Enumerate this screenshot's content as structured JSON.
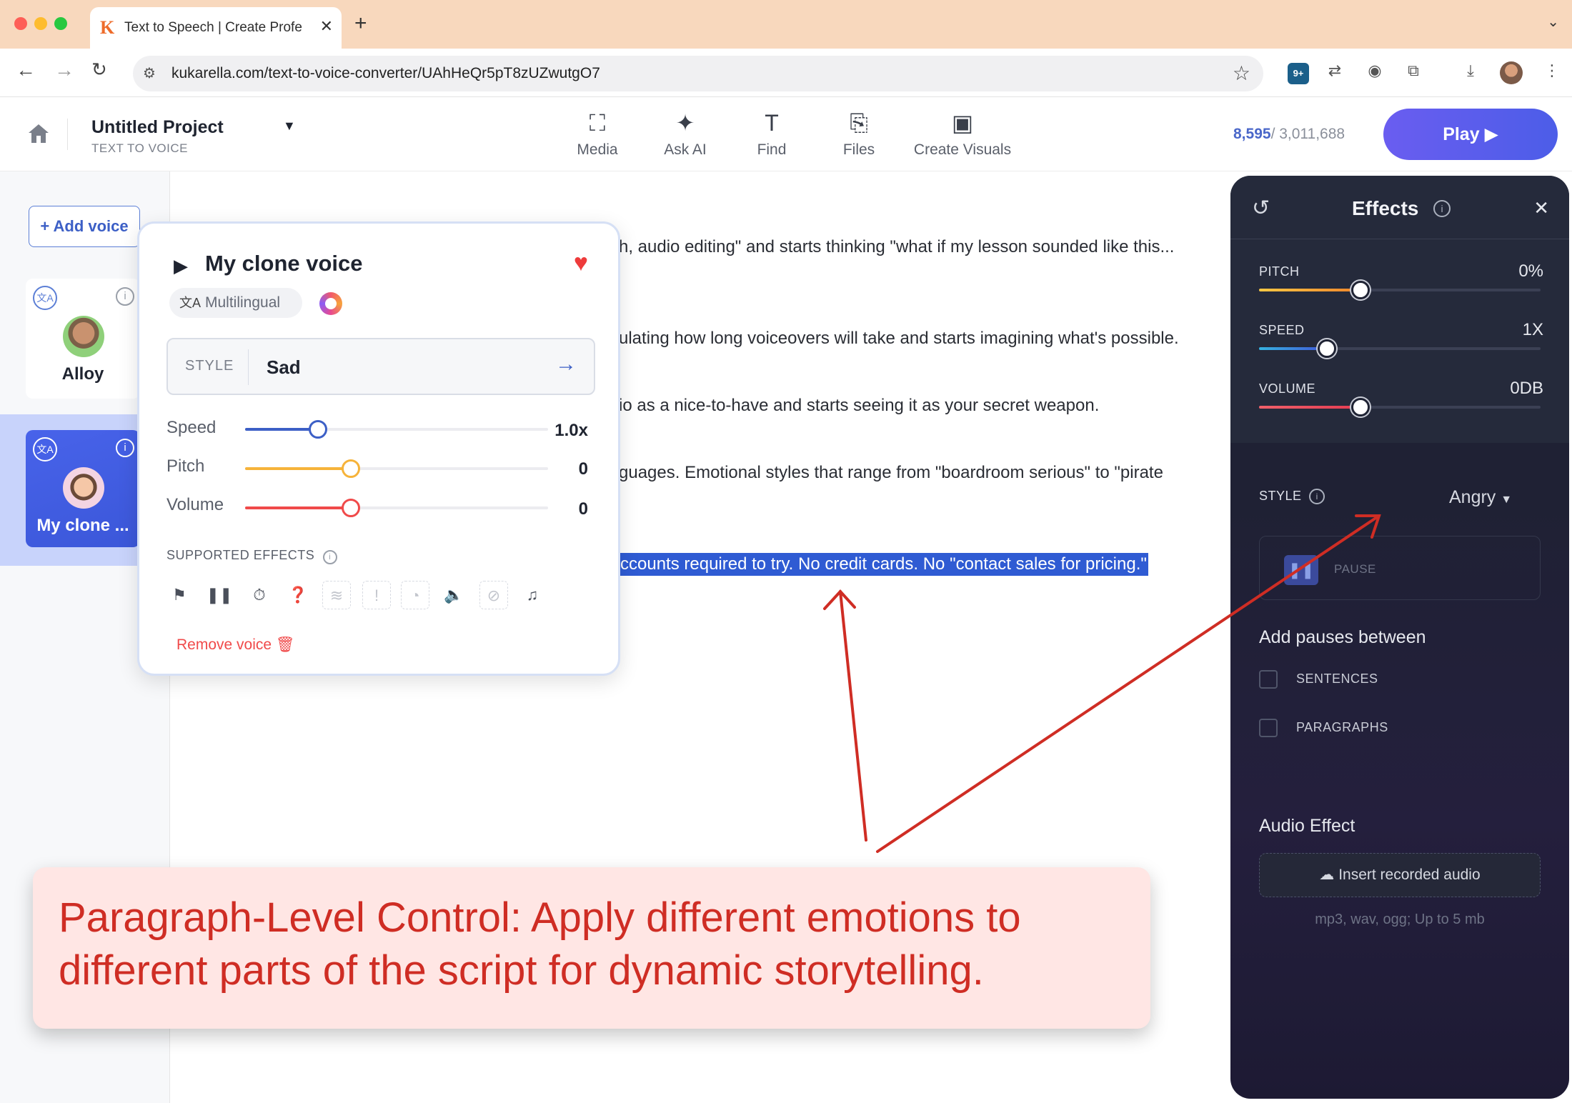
{
  "browser": {
    "tab_title": "Text to Speech | Create Profe",
    "tab_logo": "K",
    "url": "kukarella.com/text-to-voice-converter/UAhHeQr5pT8zUZwutgO7",
    "ext_badge": "9+"
  },
  "header": {
    "project_name": "Untitled Project",
    "project_sub": "TEXT TO VOICE",
    "tools": [
      {
        "icon": "media-icon",
        "label": "Media"
      },
      {
        "icon": "ask-ai-icon",
        "label": "Ask AI"
      },
      {
        "icon": "find-icon",
        "label": "Find"
      },
      {
        "icon": "files-icon",
        "label": "Files"
      },
      {
        "icon": "create-visuals-icon",
        "label": "Create Visuals"
      }
    ],
    "credits_used": "8,595",
    "credits_total": "/ 3,011,688",
    "play_label": "Play"
  },
  "sidebar": {
    "add_voice_label": "+ Add voice",
    "voices": [
      {
        "name": "Alloy"
      },
      {
        "name": "My clone ..."
      }
    ]
  },
  "editor": {
    "lines": [
      "h, audio editing\" and starts thinking \"what if my lesson sounded like this...",
      "ulating how long voiceovers will take and starts imagining what's possible.",
      "io as a nice-to-have and starts seeing it as your secret weapon.",
      "guages. Emotional styles that range from \"boardroom serious\" to \"pirate",
      "ccounts required to try. No credit cards. No \"contact sales for pricing.\""
    ]
  },
  "voice_popup": {
    "title": "My clone voice",
    "multilingual": "Multilingual",
    "style_label": "STYLE",
    "style_value": "Sad",
    "sliders": [
      {
        "label": "Speed",
        "value": "1.0x",
        "fraction": 0.24,
        "color": "#3c5fc6"
      },
      {
        "label": "Pitch",
        "value": "0",
        "fraction": 0.35,
        "color": "#f6b33a"
      },
      {
        "label": "Volume",
        "value": "0",
        "fraction": 0.35,
        "color": "#f04a4a"
      }
    ],
    "supported_effects_label": "SUPPORTED EFFECTS",
    "effect_icons": [
      "flag-icon",
      "pause-icon",
      "timer-icon",
      "hearing-icon",
      "wave-icon",
      "alert-icon",
      "ear-icon",
      "speaker-icon",
      "mic-off-icon",
      "music-icon"
    ],
    "remove_label": "Remove voice"
  },
  "effects_panel": {
    "title": "Effects",
    "sliders": [
      {
        "label": "PITCH",
        "value": "0%",
        "fraction": 0.36
      },
      {
        "label": "SPEED",
        "value": "1X",
        "fraction": 0.24
      },
      {
        "label": "VOLUME",
        "value": "0DB",
        "fraction": 0.36
      }
    ],
    "style_label": "STYLE",
    "style_value": "Angry",
    "pause_label": "PAUSE",
    "pauses_heading": "Add pauses between",
    "checkboxes": [
      {
        "label": "SENTENCES",
        "checked": false
      },
      {
        "label": "PARAGRAPHS",
        "checked": false
      }
    ],
    "audio_effect_heading": "Audio Effect",
    "insert_label": "Insert recorded audio",
    "formats": "mp3, wav, ogg; Up to 5 mb"
  },
  "annotation": {
    "text": "Paragraph-Level Control: Apply different emotions to different parts of the script for dynamic storytelling.",
    "color": "#cf2d24"
  }
}
